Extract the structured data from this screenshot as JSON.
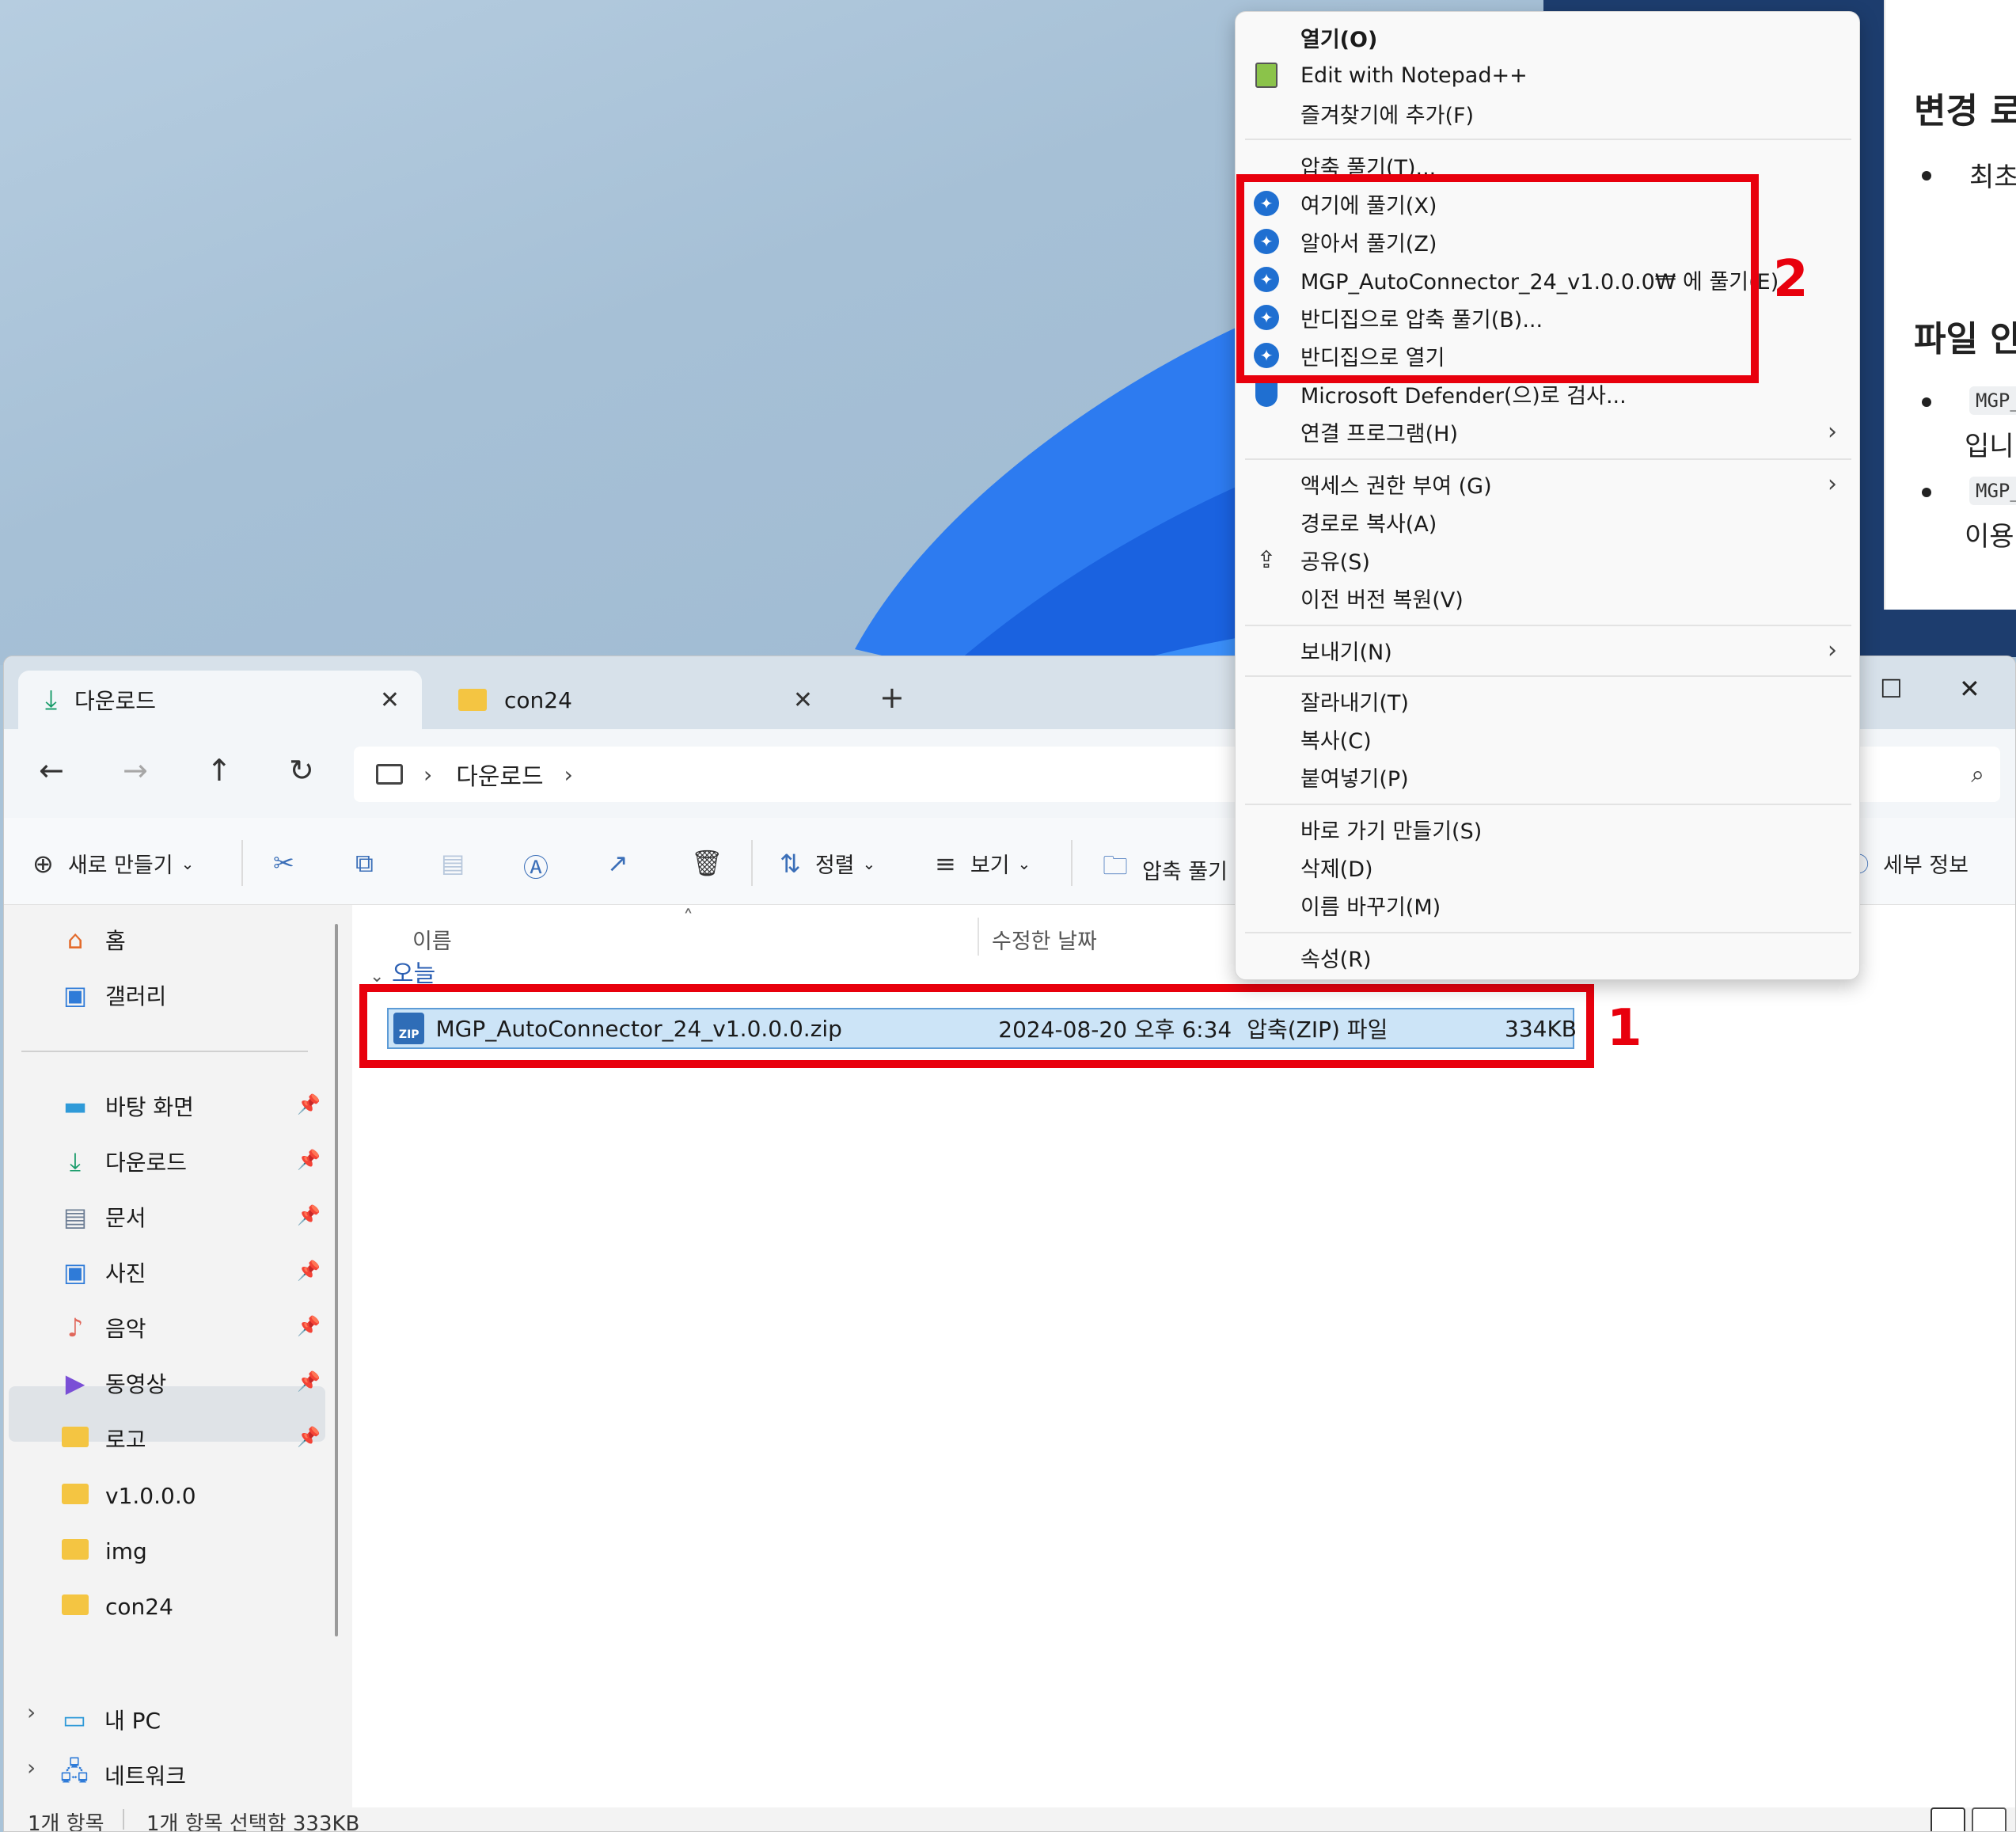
{
  "explorer": {
    "tabs": [
      {
        "label": "다운로드",
        "icon": "download-icon"
      },
      {
        "label": "con24",
        "icon": "folder-icon"
      }
    ],
    "new_tab": "+",
    "address": {
      "segments": [
        "다운로드"
      ]
    },
    "commands": {
      "new": "새로 만들기",
      "sort": "정렬",
      "view": "보기",
      "extract": "압축 풀기",
      "details": "세부 정보"
    },
    "sidebar": {
      "home": "홈",
      "gallery": "갤러리",
      "pinned": [
        "바탕 화면",
        "다운로드",
        "문서",
        "사진",
        "음악",
        "동영상",
        "로고"
      ],
      "folders": [
        "v1.0.0.0",
        "img",
        "con24"
      ],
      "pc": "내 PC",
      "network": "네트워크"
    },
    "columns": {
      "name": "이름",
      "modified": "수정한 날짜"
    },
    "group": "오늘",
    "file": {
      "name": "MGP_AutoConnector_24_v1.0.0.0.zip",
      "modified": "2024-08-20 오후 6:34",
      "type": "압축(ZIP) 파일",
      "size": "334KB"
    },
    "status": {
      "count": "1개 항목",
      "selected": "1개 항목 선택함 333KB"
    }
  },
  "context_menu": {
    "items": [
      "열기(O)",
      "Edit with Notepad++",
      "즐겨찾기에 추가(F)",
      "압축 풀기(T)...",
      "여기에 풀기(X)",
      "알아서 풀기(Z)",
      "MGP_AutoConnector_24_v1.0.0.0₩ 에 풀기(E)",
      "반디집으로 압축 풀기(B)...",
      "반디집으로 열기",
      "Microsoft Defender(으)로 검사...",
      "연결 프로그램(H)",
      "액세스 권한 부여 (G)",
      "경로로 복사(A)",
      "공유(S)",
      "이전 버전 복원(V)",
      "보내기(N)",
      "잘라내기(T)",
      "복사(C)",
      "붙여넣기(P)",
      "바로 가기 만들기(S)",
      "삭제(D)",
      "이름 바꾸기(M)",
      "속성(R)"
    ]
  },
  "annotations": {
    "label1": "1",
    "label2": "2"
  },
  "background_doc": {
    "heading1": "변경 로",
    "bullet1": "최초",
    "heading2": "파일 안",
    "chip1": "MGP_",
    "text1": "입니",
    "chip2": "MGP_",
    "text2": "이용"
  },
  "colors": {
    "accent": "#1f6fd1",
    "annotation": "#e8000d",
    "selection": "#cce4f7"
  }
}
